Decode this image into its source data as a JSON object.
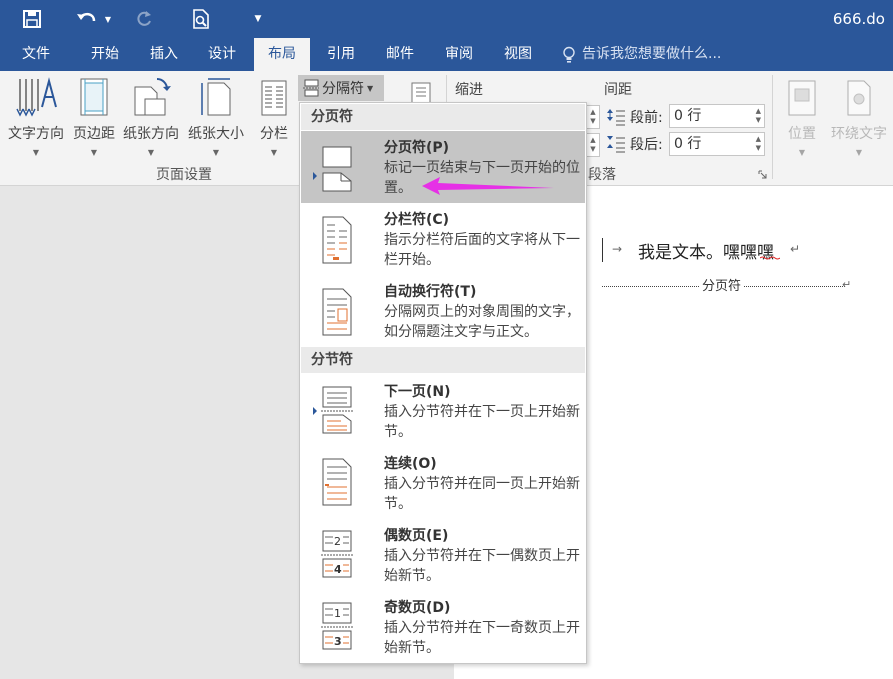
{
  "title_bar": {
    "doc_name": "666.do"
  },
  "tabs": [
    "文件",
    "开始",
    "插入",
    "设计",
    "布局",
    "引用",
    "邮件",
    "审阅",
    "视图"
  ],
  "tell_me": "告诉我您想要做什么...",
  "ribbon": {
    "text_direction": "文字方向",
    "margins": "页边距",
    "orientation": "纸张方向",
    "size": "纸张大小",
    "columns": "分栏",
    "breaks": "分隔符",
    "page_setup_group": "页面设置",
    "indent": "缩进",
    "spacing": "间距",
    "before_label": "段前:",
    "before_value": "0 行",
    "after_label": "段后:",
    "after_value": "0 行",
    "paragraph_group": "段落",
    "position": "位置",
    "wrap_text": "环绕文字"
  },
  "breaks_menu": {
    "page_breaks_header": "分页符",
    "section_breaks_header": "分节符",
    "items": [
      {
        "title": "分页符(P)",
        "desc": "标记一页结束与下一页开始的位置。",
        "icon": "page-break-icon"
      },
      {
        "title": "分栏符(C)",
        "desc": "指示分栏符后面的文字将从下一栏开始。",
        "icon": "column-break-icon"
      },
      {
        "title": "自动换行符(T)",
        "desc": "分隔网页上的对象周围的文字，如分隔题注文字与正文。",
        "icon": "text-wrapping-break-icon"
      },
      {
        "title": "下一页(N)",
        "desc": "插入分节符并在下一页上开始新节。",
        "icon": "next-page-section-icon"
      },
      {
        "title": "连续(O)",
        "desc": "插入分节符并在同一页上开始新节。",
        "icon": "continuous-section-icon"
      },
      {
        "title": "偶数页(E)",
        "desc": "插入分节符并在下一偶数页上开始新节。",
        "icon": "even-page-section-icon",
        "num1": "2",
        "num2": "4"
      },
      {
        "title": "奇数页(D)",
        "desc": "插入分节符并在下一奇数页上开始新节。",
        "icon": "odd-page-section-icon",
        "num1": "1",
        "num2": "3"
      }
    ]
  },
  "document": {
    "text": "我是文本。嘿嘿嘿",
    "page_break_label": "分页符"
  },
  "colors": {
    "accent": "#2b579a",
    "arrow": "#e630e6",
    "highlight": "#c5c5c5",
    "icon_orange": "#e07030"
  }
}
